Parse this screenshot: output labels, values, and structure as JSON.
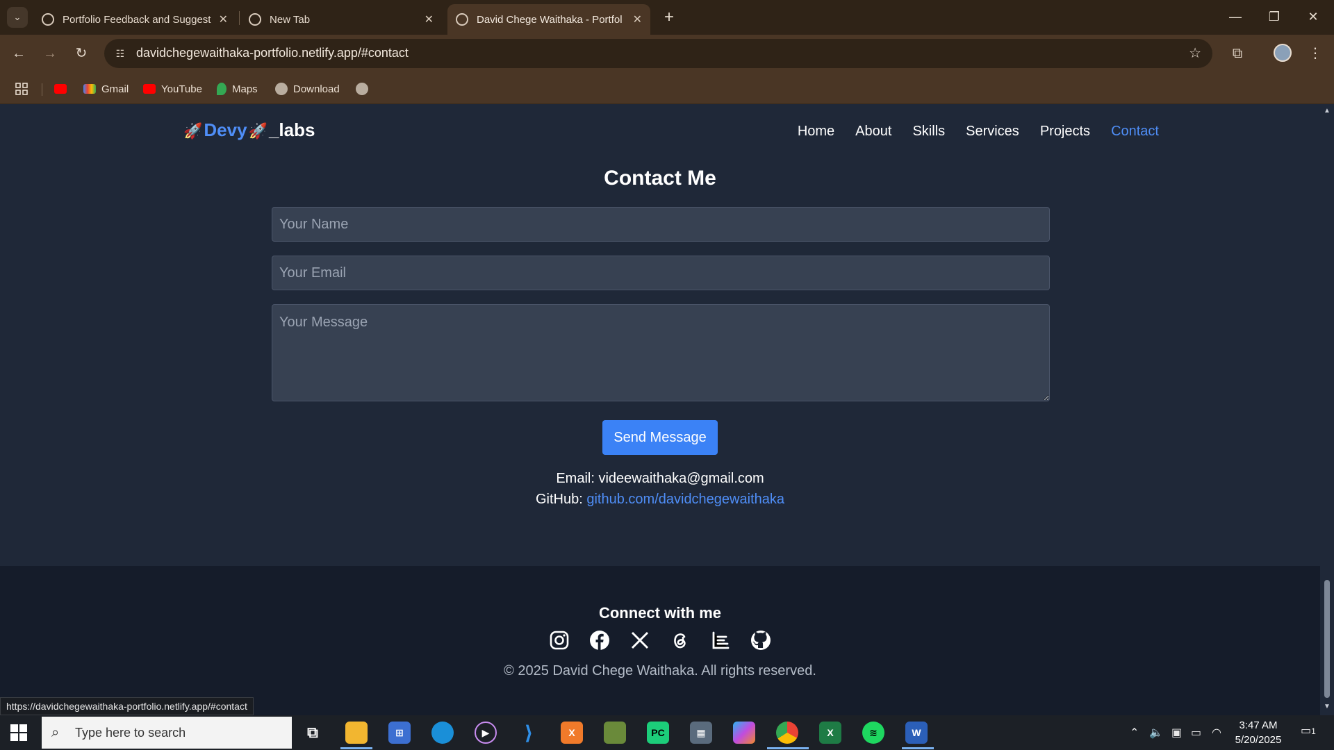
{
  "browser": {
    "tabs": [
      {
        "title": "Portfolio Feedback and Suggest",
        "active": false
      },
      {
        "title": "New Tab",
        "active": false
      },
      {
        "title": "David Chege Waithaka - Portfol",
        "active": true
      }
    ],
    "url": "davidchegewaithaka-portfolio.netlify.app/#contact",
    "bookmarks": [
      "Gmail",
      "YouTube",
      "Maps",
      "Download"
    ],
    "status_url": "https://davidchegewaithaka-portfolio.netlify.app/#contact"
  },
  "site": {
    "logo": {
      "brand": "Devy",
      "suffix": "_labs"
    },
    "nav": [
      "Home",
      "About",
      "Skills",
      "Services",
      "Projects",
      "Contact"
    ],
    "active_nav": "Contact",
    "accent_color": "#4f8ef7",
    "contact": {
      "title": "Contact Me",
      "name_placeholder": "Your Name",
      "email_placeholder": "Your Email",
      "message_placeholder": "Your Message",
      "send_label": "Send Message",
      "email_line_label": "Email: ",
      "email": "videewaithaka@gmail.com",
      "github_label": "GitHub: ",
      "github": "github.com/davidchegewaithaka"
    },
    "footer": {
      "connect_title": "Connect with me",
      "social_icons": [
        "instagram-icon",
        "facebook-icon",
        "x-icon",
        "threads-icon",
        "medium-icon",
        "github-icon"
      ],
      "copyright": "© 2025 David Chege Waithaka. All rights reserved."
    }
  },
  "taskbar": {
    "search_placeholder": "Type here to search",
    "time": "3:47 AM",
    "date": "5/20/2025",
    "notification_count": "1"
  }
}
